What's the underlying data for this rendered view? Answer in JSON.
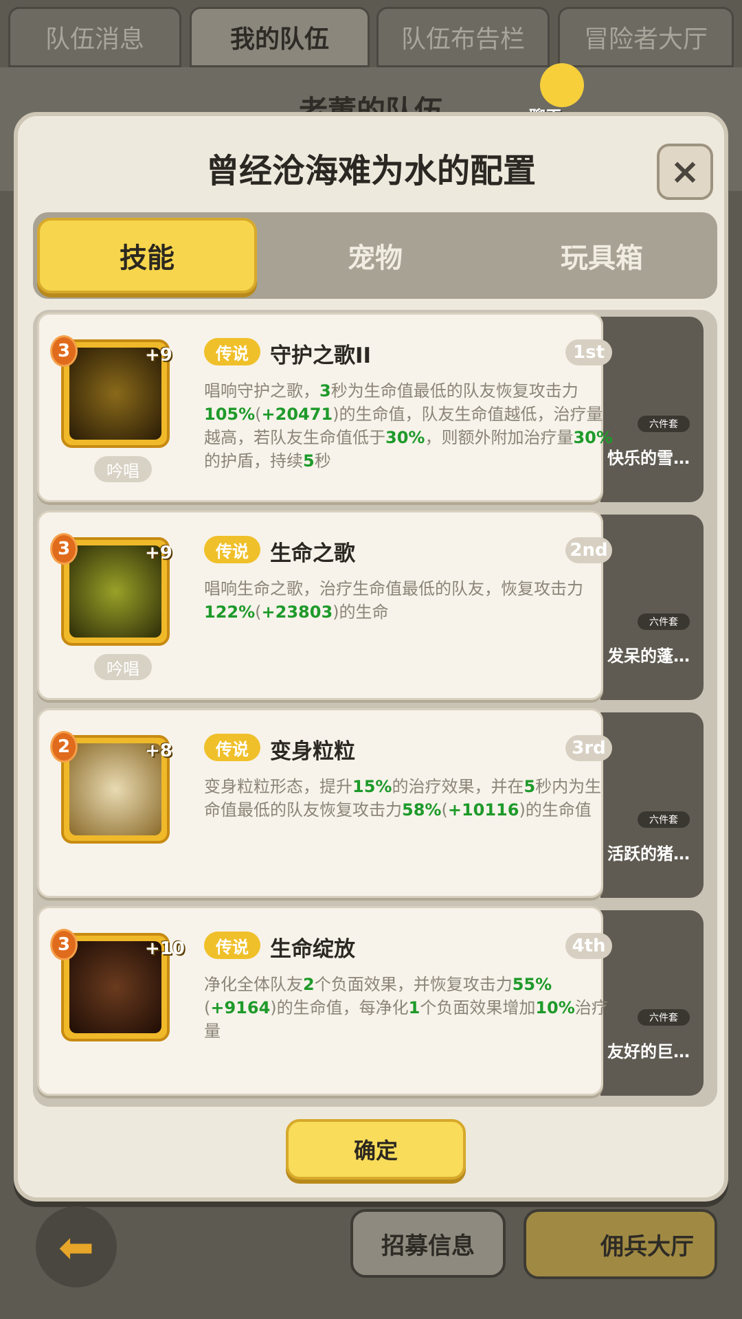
{
  "top_tabs": [
    "队伍消息",
    "我的队伍",
    "队伍布告栏",
    "冒险者大厅"
  ],
  "behind_title": "老董的队伍",
  "chat_label": "聊天",
  "modal": {
    "title": "曾经沧海难为水的配置",
    "close_symbol": "×",
    "tabs": [
      "技能",
      "宠物",
      "玩具箱"
    ],
    "confirm_label": "确定"
  },
  "skills": [
    {
      "level": "3",
      "plus": "+9",
      "type": "吟唱",
      "rarity": "传说",
      "name": "守护之歌II",
      "rank": "1st",
      "desc": "唱响守护之歌，3秒为生命值最低的队友恢复攻击力105%(+20471)的生命值，队友生命值越低，治疗量越高，若队友生命值低于30%，则额外附加治疗量30%的护盾，持续5秒",
      "pet_badge": "六件套",
      "pet_name": "快乐的雪…"
    },
    {
      "level": "3",
      "plus": "+9",
      "type": "吟唱",
      "rarity": "传说",
      "name": "生命之歌",
      "rank": "2nd",
      "desc": "唱响生命之歌，治疗生命值最低的队友，恢复攻击力122%(+23803)的生命",
      "pet_badge": "六件套",
      "pet_name": "发呆的蓬…"
    },
    {
      "level": "2",
      "plus": "+8",
      "type": "",
      "rarity": "传说",
      "name": "变身粒粒",
      "rank": "3rd",
      "desc": "变身粒粒形态，提升15%的治疗效果，并在5秒内为生命值最低的队友恢复攻击力58%(+10116)的生命值",
      "pet_badge": "六件套",
      "pet_name": "活跃的猪…"
    },
    {
      "level": "3",
      "plus": "+10",
      "type": "",
      "rarity": "传说",
      "name": "生命绽放",
      "rank": "4th",
      "desc": "净化全体队友2个负面效果，并恢复攻击力55%(+9164)的生命值，每净化1个负面效果增加10%治疗量",
      "pet_badge": "六件套",
      "pet_name": "友好的巨…"
    }
  ],
  "bottom": {
    "back_symbol": "⬅",
    "recruit_label": "招募信息",
    "merc_label": "佣兵大厅"
  }
}
